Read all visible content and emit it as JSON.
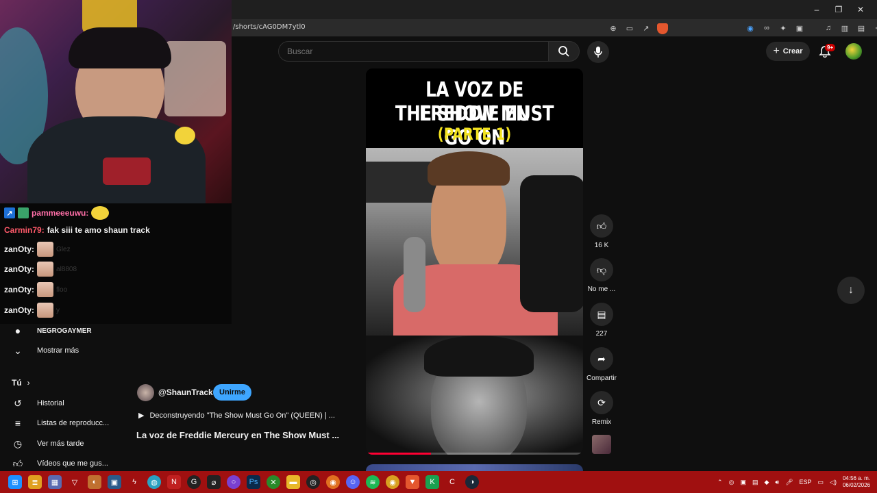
{
  "browser": {
    "url": "/shorts/cAG0DM7ytl0",
    "window_controls": [
      "–",
      "❐",
      "✕"
    ]
  },
  "header": {
    "search_placeholder": "Buscar",
    "create_label": "Crear",
    "notifications_badge": "9+"
  },
  "chat": {
    "messages": [
      {
        "user": "pammeeeuwu:",
        "text": "",
        "user_color": "#ff6fa8"
      },
      {
        "user": "Carmin79:",
        "text": "fak siii te amo shaun track",
        "user_color": "#ff5a6a"
      },
      {
        "user": "zanOty:",
        "text": "Glez",
        "user_color": "#f1f1f1"
      },
      {
        "user": "zanOty:",
        "text": "al8808",
        "user_color": "#f1f1f1"
      },
      {
        "user": "zanOty:",
        "text": "floo",
        "user_color": "#f1f1f1"
      },
      {
        "user": "zanOty:",
        "text": "y",
        "user_color": "#f1f1f1"
      }
    ]
  },
  "sidebar": {
    "partial_item": "NEGROGAYMER",
    "show_more": "Mostrar más",
    "you_section": "Tú",
    "items": [
      {
        "label": "Historial",
        "icon": "history-icon"
      },
      {
        "label": "Listas de reproducc...",
        "icon": "playlists-icon"
      },
      {
        "label": "Ver más tarde",
        "icon": "watch-later-icon"
      },
      {
        "label": "Vídeos que me gus...",
        "icon": "liked-icon"
      }
    ]
  },
  "video": {
    "title_line1": "LA VOZ DE FREDDIE EN",
    "title_line2": "THE SHOW MUST GO ON",
    "title_line3": "(PARTE 1)",
    "progress": 0.3
  },
  "actions": {
    "likes": "16 K",
    "dislike": "No me ...",
    "comments": "227",
    "share": "Compartir",
    "remix": "Remix"
  },
  "channel": {
    "name": "@ShaunTrack",
    "join": "Unirme",
    "music": "Deconstruyendo \"The Show Must Go On\" (QUEEN) | ...",
    "title": "La voz de Freddie Mercury en The Show Must ..."
  },
  "taskbar": {
    "lang": "ESP",
    "time": "04:56 a. m.",
    "date": "06/02/2026"
  },
  "colors": {
    "taskbar": "#a01010",
    "accent_blue": "#3ea6ff",
    "progress_red": "#ff0033"
  }
}
